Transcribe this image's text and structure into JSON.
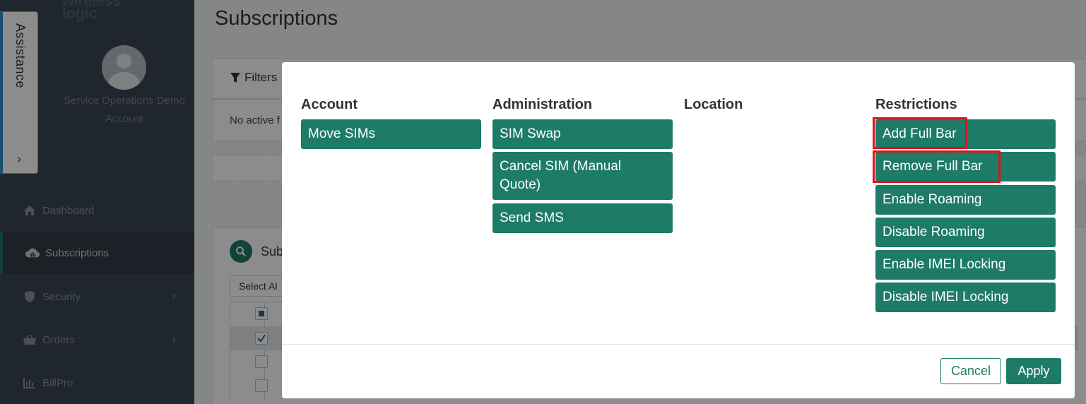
{
  "app": {
    "logo_text": "wireless logic"
  },
  "assistance": {
    "label": "Assistance"
  },
  "sidebar": {
    "account_name": "Service Operations Demo Account",
    "items": [
      {
        "label": "Dashboard",
        "icon": "home-icon"
      },
      {
        "label": "Subscriptions",
        "icon": "cloud-signal-icon",
        "active": true
      },
      {
        "label": "Security",
        "icon": "shield-icon"
      },
      {
        "label": "Orders",
        "icon": "basket-icon"
      },
      {
        "label": "BillPro",
        "icon": "bar-chart-icon"
      }
    ]
  },
  "page": {
    "title": "Subscriptions",
    "filters_label": "Filters",
    "no_active_filters": "No active f",
    "subscriptions_section": "Sub",
    "select_all": "Select Al"
  },
  "modal": {
    "columns": [
      {
        "title": "Account",
        "actions": [
          "Move SIMs"
        ]
      },
      {
        "title": "Administration",
        "actions": [
          "SIM Swap",
          "Cancel SIM (Manual Quote)",
          "Send SMS"
        ]
      },
      {
        "title": "Location",
        "actions": []
      },
      {
        "title": "Restrictions",
        "actions": [
          "Add Full Bar",
          "Remove Full Bar",
          "Enable Roaming",
          "Disable Roaming",
          "Enable IMEI Locking",
          "Disable IMEI Locking"
        ]
      }
    ],
    "cancel_label": "Cancel",
    "apply_label": "Apply"
  },
  "colors": {
    "accent": "#1e7b68",
    "highlight": "#e1121a",
    "sidebar": "#3a4552"
  }
}
